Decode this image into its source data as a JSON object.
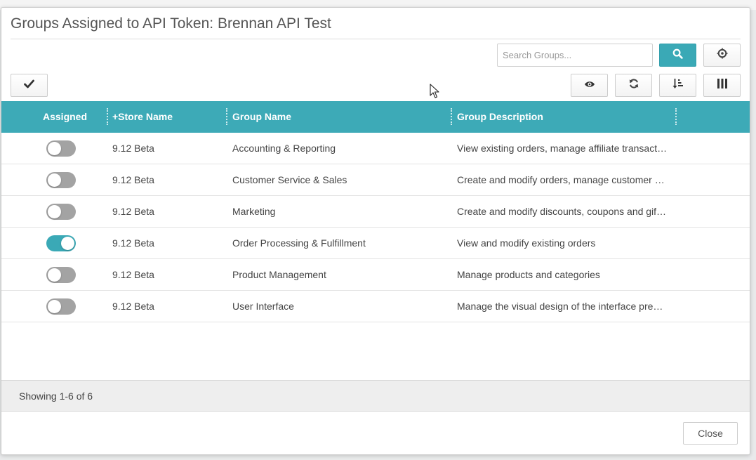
{
  "window": {
    "title": "Groups Assigned to API Token: Brennan API Test"
  },
  "background_strip": {
    "items": [
      "...",
      "...",
      "...",
      "..."
    ]
  },
  "toolbar": {
    "search_placeholder": "Search Groups...",
    "search_button_icon": "search-icon",
    "reset_button_icon": "target-icon",
    "select_button_icon": "checkmark-icon",
    "view_button_icon": "eye-icon",
    "refresh_button_icon": "refresh-icon",
    "sort_button_icon": "sort-icon",
    "columns_button_icon": "columns-icon"
  },
  "grid": {
    "columns": [
      "Assigned",
      "+Store Name",
      "Group Name",
      "Group Description"
    ],
    "rows": [
      {
        "assigned": false,
        "store": "9.12 Beta",
        "group": "Accounting & Reporting",
        "description": "View existing orders, manage affiliate transact…"
      },
      {
        "assigned": false,
        "store": "9.12 Beta",
        "group": "Customer Service & Sales",
        "description": "Create and modify orders, manage customer …"
      },
      {
        "assigned": false,
        "store": "9.12 Beta",
        "group": "Marketing",
        "description": "Create and modify discounts, coupons and gif…"
      },
      {
        "assigned": true,
        "store": "9.12 Beta",
        "group": "Order Processing & Fulfillment",
        "description": "View and modify existing orders"
      },
      {
        "assigned": false,
        "store": "9.12 Beta",
        "group": "Product Management",
        "description": "Manage products and categories"
      },
      {
        "assigned": false,
        "store": "9.12 Beta",
        "group": "User Interface",
        "description": "Manage the visual design of the interface pre…"
      }
    ]
  },
  "footer": {
    "status": "Showing 1-6 of 6",
    "close_label": "Close"
  },
  "colors": {
    "accent": "#3daab7",
    "toggle_off": "#a3a3a3"
  }
}
